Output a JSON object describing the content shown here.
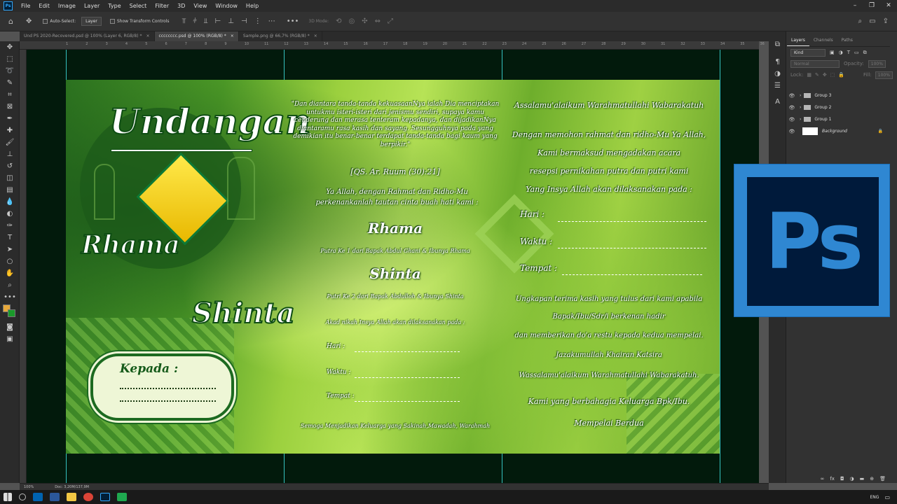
{
  "app": {
    "name": "Ps"
  },
  "menu": [
    "File",
    "Edit",
    "Image",
    "Layer",
    "Type",
    "Select",
    "Filter",
    "3D",
    "View",
    "Window",
    "Help"
  ],
  "options": {
    "auto_select": "Auto-Select:",
    "auto_select_target": "Layer",
    "show_transform": "Show Transform Controls",
    "mode_3d": "3D Mode:"
  },
  "tabs": [
    {
      "label": "Und PS 2020-Recovered.psd @ 100% (Layer 6, RGB/8) *"
    },
    {
      "label": "cccccccc.psd @ 100% (RGB/8) *"
    },
    {
      "label": "Sample.png @ 66,7% (RGB/8) *"
    }
  ],
  "ruler_ticks": [
    "1",
    "2",
    "3",
    "4",
    "5",
    "6",
    "7",
    "8",
    "9",
    "10",
    "11",
    "12",
    "13",
    "14",
    "15",
    "16",
    "17",
    "18",
    "19",
    "20",
    "21",
    "22",
    "23",
    "24",
    "25",
    "26",
    "27",
    "28",
    "29",
    "30",
    "31",
    "32",
    "33",
    "34",
    "35",
    "36",
    "37"
  ],
  "invitation": {
    "left": {
      "title": "Undangan",
      "bride": "Rhama",
      "groom": "Shinta",
      "kepada": "Kepada :"
    },
    "middle": {
      "verse": "\"Dan diantara tanda-tanda kekuasaanNya ialah Dia menciptakan untukmu isteri-isteri dari jenismu sendiri, supaya kamu cenderung dan merasa tenteram kepadanya, dan dijadikanNya diantaramu rasa kasih dan sayang. Sesungguhnya pada yang demikian itu benar-benar terdapat tanda-tanda bagi kaum yang berpikir.\"",
      "verse_ref": "[QS. Ar. Ruum (30):21]",
      "prayer": "Ya Allah, dengan Rahmat dan Ridho-Mu perkenankanlah tautan cinta buah hati kami :",
      "name1": "Rhama",
      "name1_desc": "Putra Ke 1 dari Bapak Abdul Ghani & Ibunya Rhama",
      "name2": "Shinta",
      "name2_desc": "Putri Ke 2 dari Bapak Abdulloh & Ibunya Shinta",
      "akad": "Akad nikah Insya Allah akan dilaksanakan pada :",
      "hari": "Hari :",
      "waktu": "Waktu :",
      "tempat": "Tempat :",
      "closing": "Semoga Menjadikan Keluarga yang Sakinah,Mawadah, Warahmah"
    },
    "right": {
      "salam": "Assalamu'alaikum Warahmatullahi Wabarakatuh",
      "l1": "Dengan memohon rahmat dan ridho-Mu Ya Allah,",
      "l2": "Kami bermaksud mengadakan acara",
      "l3": "resepsi pernikahan putra dan putri kami",
      "l4": "Yang Insya Allah akan dilaksanakan pada :",
      "hari": "Hari :",
      "waktu": "Waktu :",
      "tempat": "Tempat :",
      "t1": "Ungkapan terima kasih yang tulus dari kami apabila",
      "t2": "Bapak/Ibu/Sdr/i berkenan hadir",
      "t3": "dan memberikan do'a restu kepada kedua mempelai.",
      "t4": "Jazakumullah Khairan Katsira",
      "t5": "Wassalamu'alaikum Warahmatullahi Wabarakatuh.",
      "t6": "Kami yang berbahagia Keluarga Bpk/Ibu.",
      "t7": "Mempelai Berdua"
    }
  },
  "layers_panel": {
    "tabs": [
      "Layers",
      "Channels",
      "Paths"
    ],
    "filter": "Kind",
    "blend": "Normal",
    "opacity_label": "Opacity:",
    "opacity": "100%",
    "lock_label": "Lock:",
    "fill_label": "Fill:",
    "fill": "100%",
    "layers": [
      "Group 3",
      "Group 2",
      "Group 1",
      "Background"
    ]
  },
  "status": {
    "zoom": "100%",
    "doc": "Doc: 3,20M/137,9M"
  },
  "taskbar": {
    "lang": "ENG"
  },
  "colors": {
    "accent": "#31a8ff",
    "canvas_bg": "#021a0c",
    "guide": "#35c2c0"
  }
}
